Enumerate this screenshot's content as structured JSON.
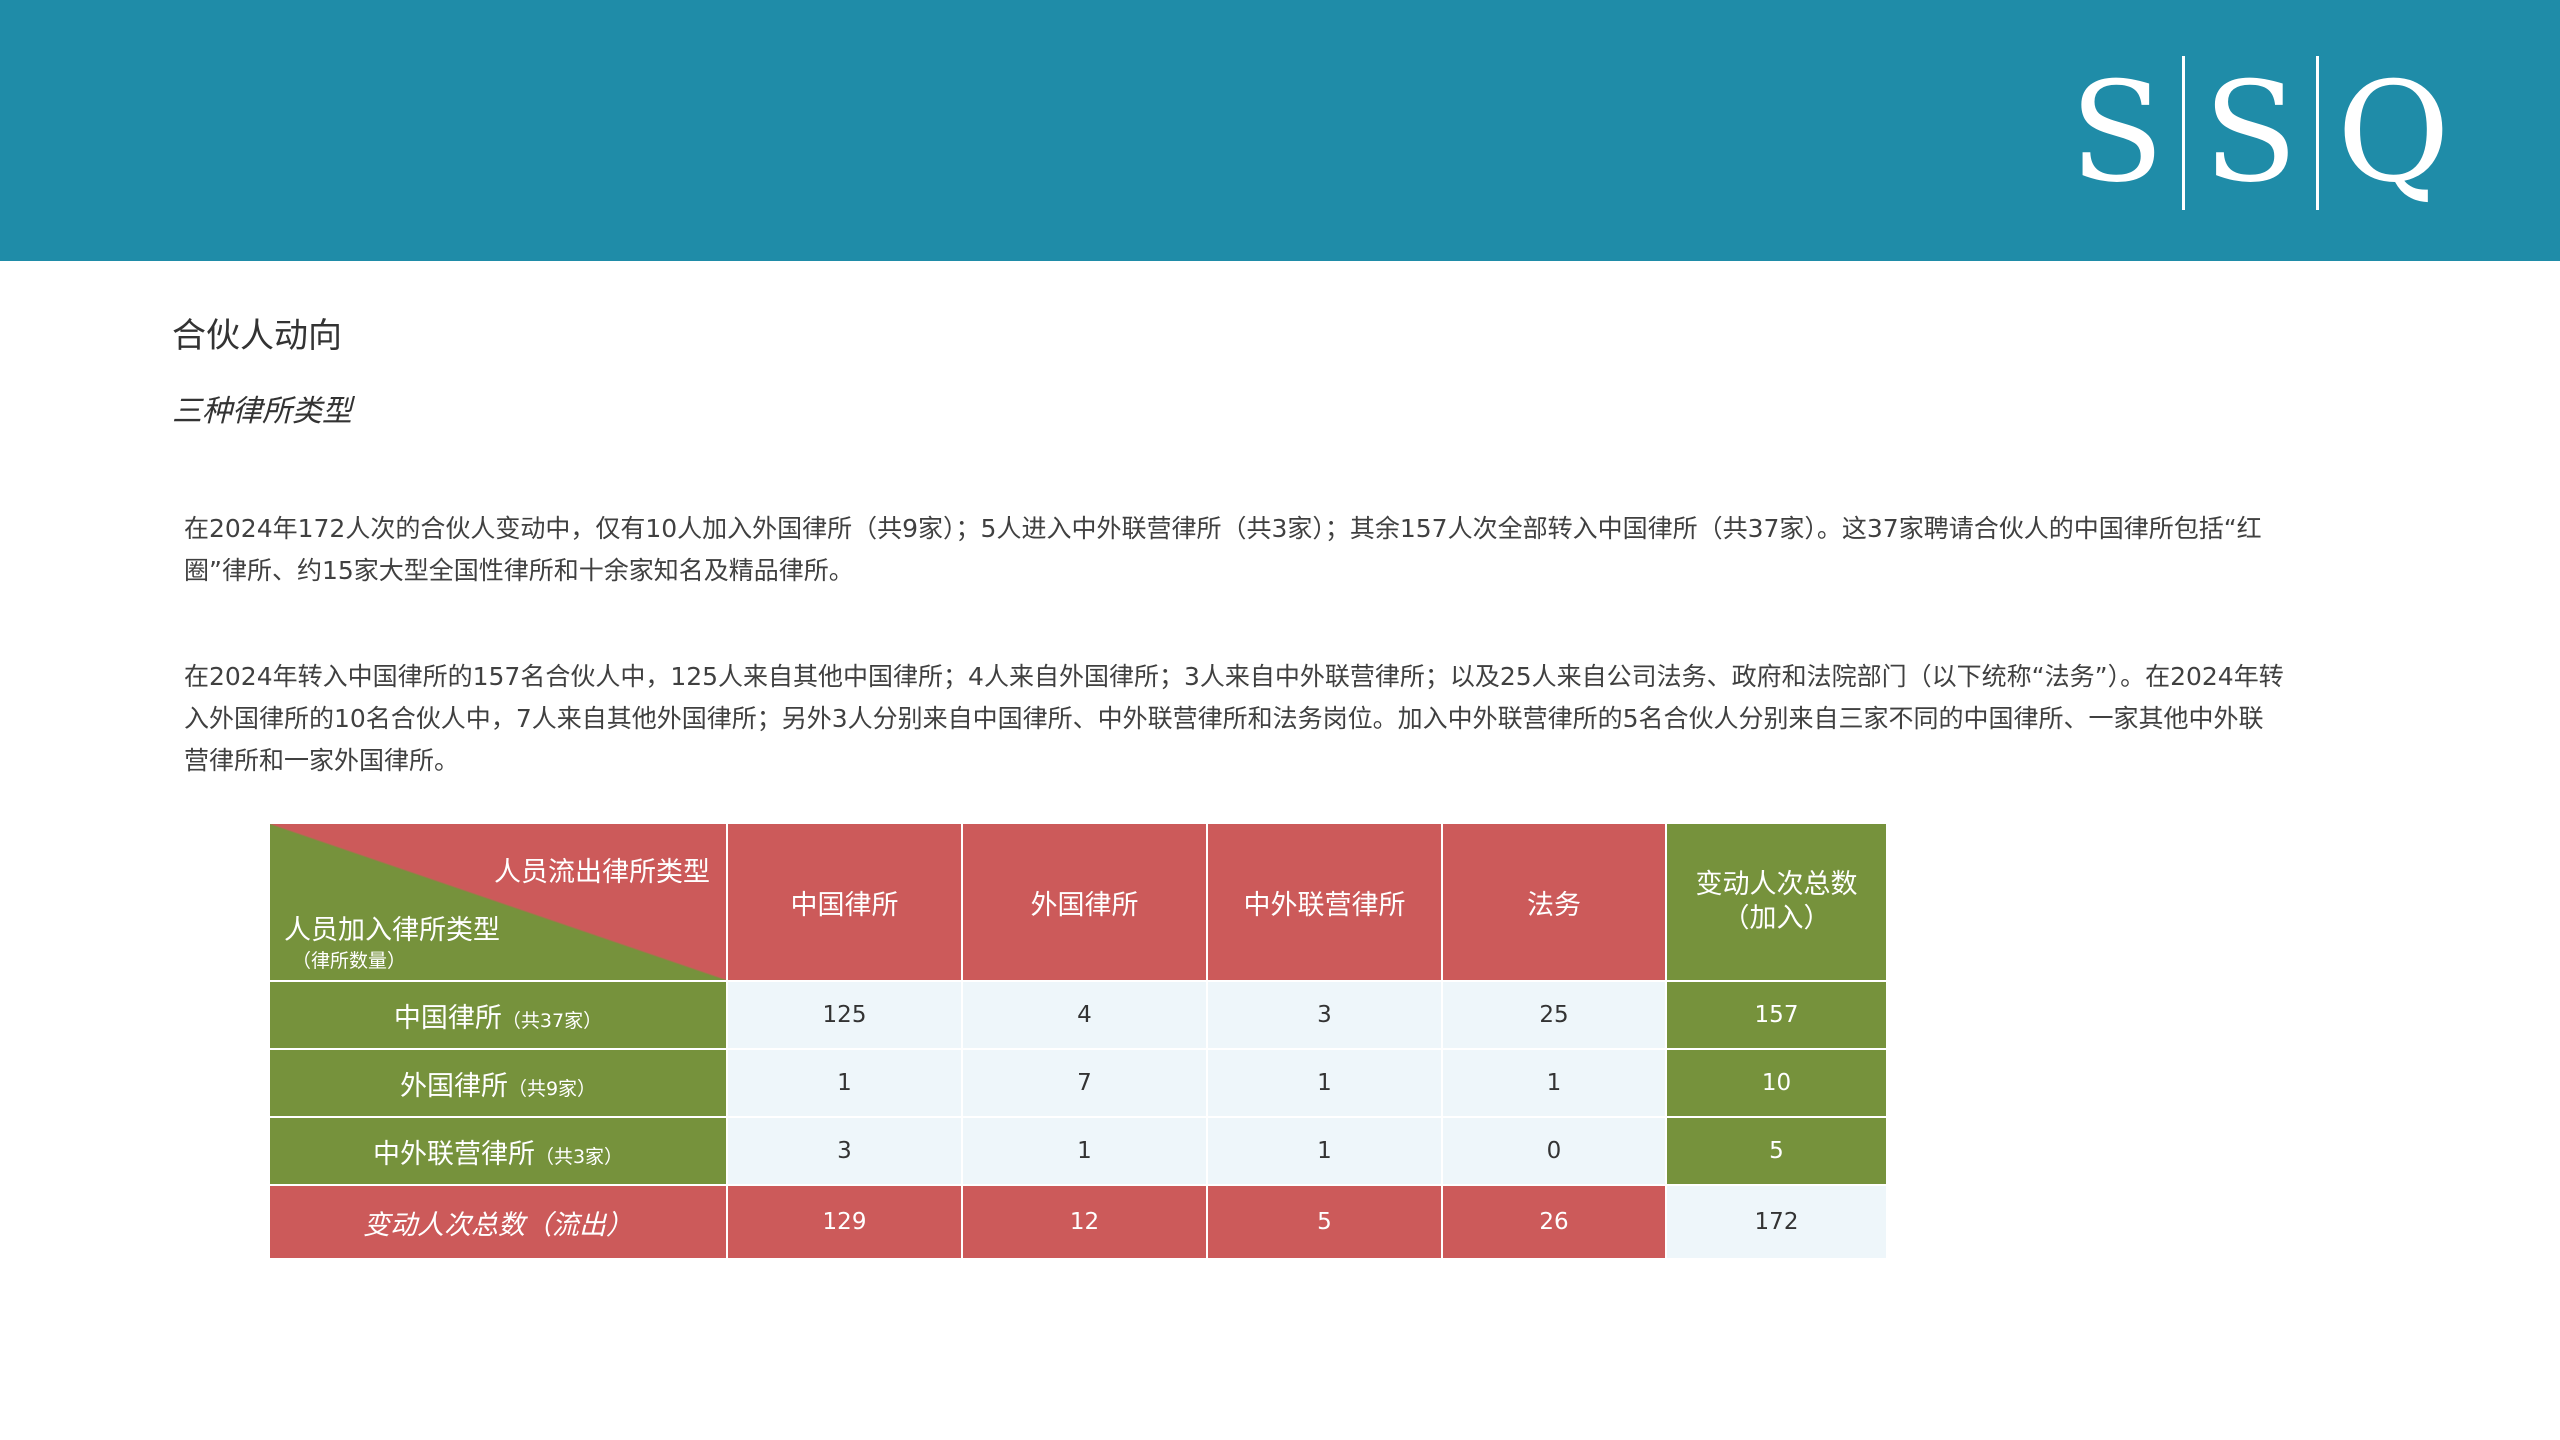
{
  "colors": {
    "header_band": "#1f8ca8",
    "red": "#cc5a5a",
    "green": "#76923c",
    "cell": "#eef6fa"
  },
  "logo": {
    "letters": [
      "S",
      "S",
      "Q"
    ]
  },
  "section": {
    "title": "合伙人动向",
    "subtitle": "三种律所类型"
  },
  "paragraphs": [
    "在2024年172人次的合伙人变动中，仅有10人加入外国律所（共9家）；5人进入中外联营律所（共3家）；其余157人次全部转入中国律所（共37家）。这37家聘请合伙人的中国律所包括“红圈”律所、约15家大型全国性律所和十余家知名及精品律所。",
    "在2024年转入中国律所的157名合伙人中，125人来自其他中国律所；4人来自外国律所；3人来自中外联营律所；以及25人来自公司法务、政府和法院部门（以下统称“法务”）。在2024年转入外国律所的10名合伙人中，7人来自其他外国律所；另外3人分别来自中国律所、中外联营律所和法务岗位。加入中外联营律所的5名合伙人分别来自三家不同的中国律所、一家其他中外联营律所和一家外国律所。"
  ],
  "table": {
    "corner_top": "人员流出律所类型",
    "corner_bottom": "人员加入律所类型",
    "corner_sub": "（律所数量）",
    "columns": [
      "中国律所",
      "外国律所",
      "中外联营律所",
      "法务"
    ],
    "total_col_line1": "变动人次总数",
    "total_col_line2": "（加入）",
    "rows": [
      {
        "label": "中国律所",
        "count": "（共37家）",
        "values": [
          "125",
          "4",
          "3",
          "25"
        ],
        "total": "157"
      },
      {
        "label": "外国律所",
        "count": "（共9家）",
        "values": [
          "1",
          "7",
          "1",
          "1"
        ],
        "total": "10"
      },
      {
        "label": "中外联营律所",
        "count": "（共3家）",
        "values": [
          "3",
          "1",
          "1",
          "0"
        ],
        "total": "5"
      }
    ],
    "footer_label": "变动人次总数（流出）",
    "footer_values": [
      "129",
      "12",
      "5",
      "26"
    ],
    "grand_total": "172"
  }
}
